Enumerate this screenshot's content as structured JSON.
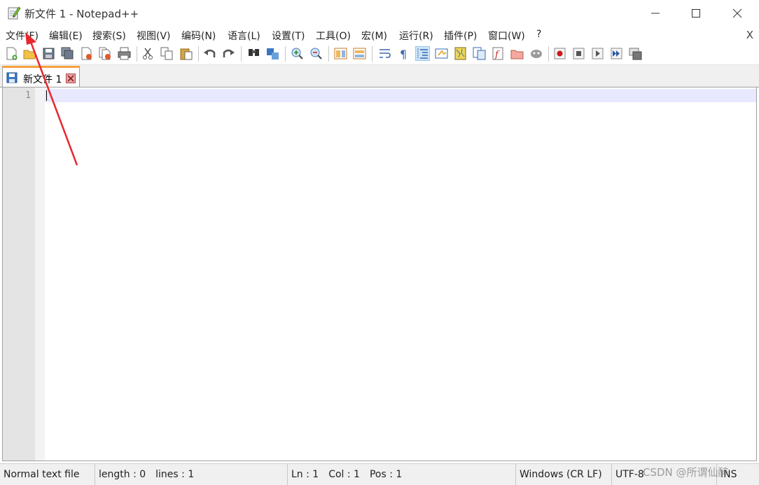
{
  "window": {
    "title": "新文件 1 - Notepad++",
    "icon": "notepad-icon",
    "controls": [
      "minimize-icon",
      "maximize-icon",
      "close-icon"
    ]
  },
  "menu": {
    "items": [
      "文件(F)",
      "编辑(E)",
      "搜索(S)",
      "视图(V)",
      "编码(N)",
      "语言(L)",
      "设置(T)",
      "工具(O)",
      "宏(M)",
      "运行(R)",
      "插件(P)",
      "窗口(W)",
      "?"
    ],
    "close_label": "X"
  },
  "toolbar": {
    "icons": [
      "new-file-icon",
      "open-file-icon",
      "save-icon",
      "save-all-icon",
      "close-icon",
      "close-all-icon",
      "print-icon",
      "cut-icon",
      "copy-icon",
      "paste-icon",
      "undo-icon",
      "redo-icon",
      "find-icon",
      "replace-icon",
      "zoom-in-icon",
      "zoom-out-icon",
      "sync-vertical-icon",
      "sync-horizontal-icon",
      "word-wrap-icon",
      "show-all-characters-icon",
      "indent-guide-icon",
      "user-defined-language-icon",
      "document-map-icon",
      "function-list-icon",
      "folder-as-workspace-icon",
      "document-list-icon",
      "monitoring-icon",
      "record-macro-icon",
      "stop-recording-icon",
      "playback-macro-icon",
      "run-macro-multiple-icon",
      "save-macro-icon"
    ],
    "active": "indent-guide-icon"
  },
  "tabs": [
    {
      "label": "新文件 1",
      "saved": true
    }
  ],
  "editor": {
    "line_numbers": [
      "1"
    ],
    "content": "",
    "current_line_color": "#e8e8ff"
  },
  "status": {
    "file_type": "Normal text file",
    "length": "length : 0",
    "lines": "lines : 1",
    "ln": "Ln : 1",
    "col": "Col : 1",
    "pos": "Pos : 1",
    "eol": "Windows (CR LF)",
    "encoding": "UTF-8",
    "mode": "INS"
  },
  "watermark": "CSDN @所谓仙醉",
  "colors": {
    "tab_accent": "#f7a13b",
    "annotation_arrow": "#e8272f"
  }
}
